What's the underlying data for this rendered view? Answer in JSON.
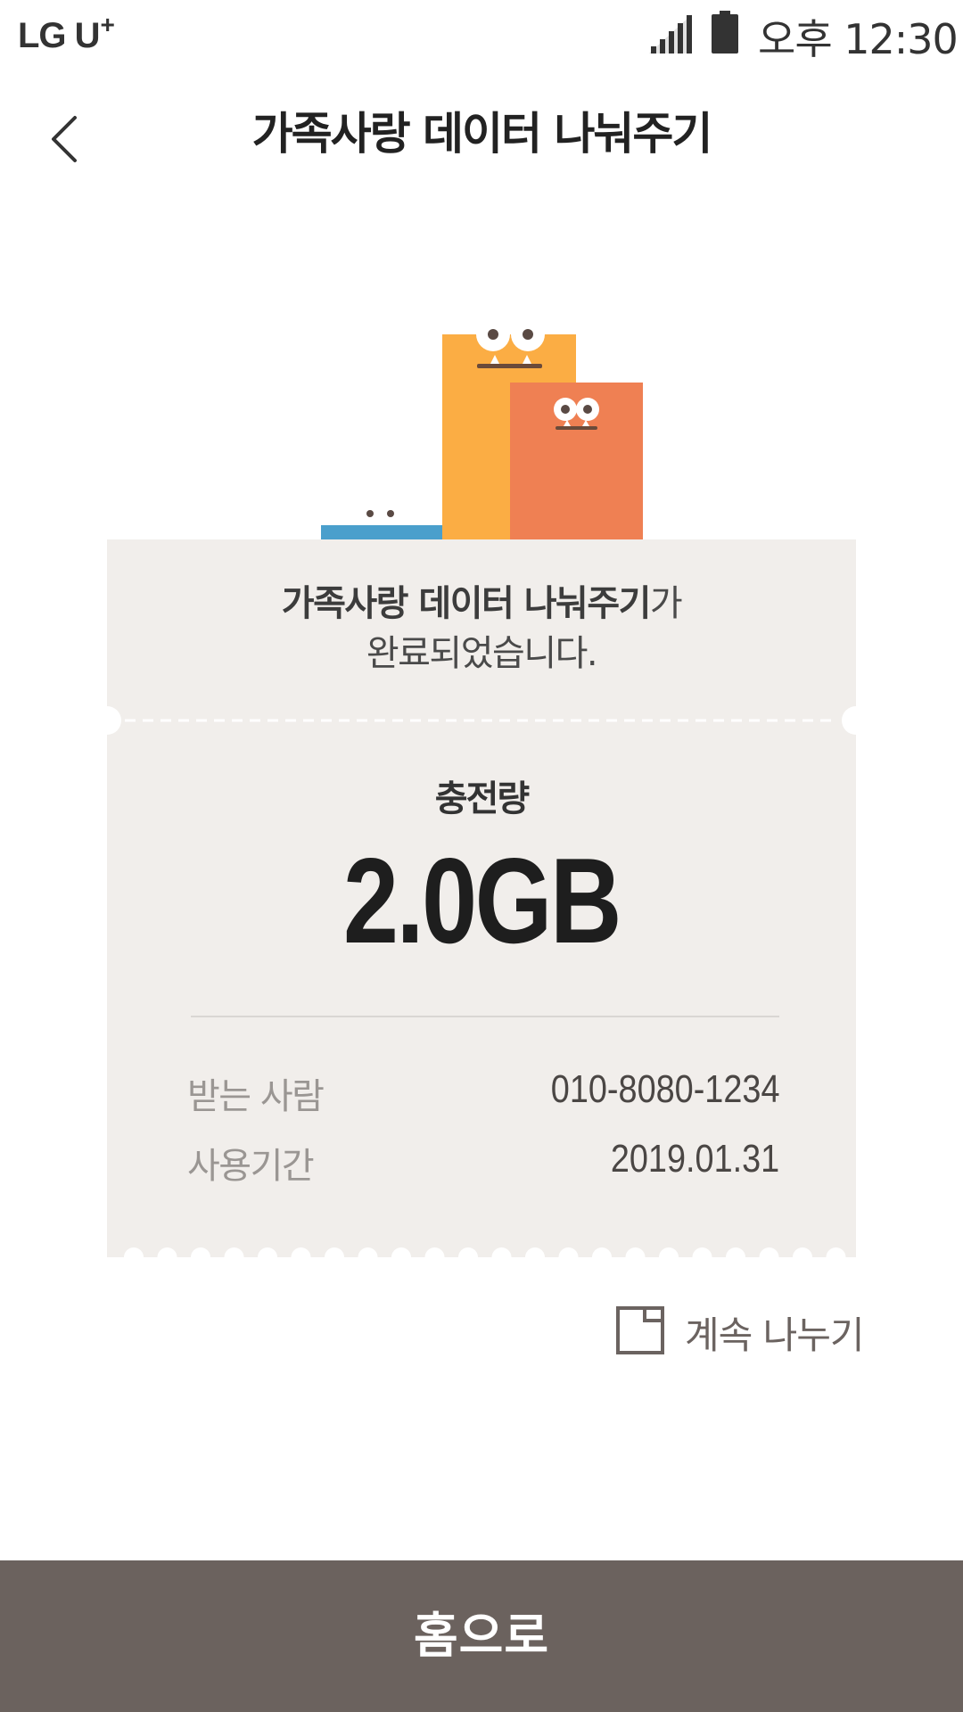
{
  "status_bar": {
    "carrier": "LG U",
    "carrier_sup": "+",
    "time": "오후 12:30",
    "icons": [
      "signal-icon",
      "battery-icon"
    ]
  },
  "header": {
    "back_icon": "chevron-left-icon",
    "title": "가족사랑 데이터 나눠주기"
  },
  "result": {
    "message_bold": "가족사랑 데이터 나눠주기",
    "message_suffix": "가",
    "message_line2": "완료되었습니다.",
    "charge_label": "충전량",
    "charge_amount": "2.0GB"
  },
  "details": [
    {
      "label": "받는 사람",
      "value": "010-8080-1234"
    },
    {
      "label": "사용기간",
      "value": "2019.01.31"
    }
  ],
  "continue_share": {
    "icon": "note-icon",
    "label": "계속 나누기"
  },
  "home_button": {
    "label": "홈으로"
  },
  "colors": {
    "ticket_bg": "#f1eeeb",
    "button_bg": "#6b625e",
    "character_yellow": "#fbad44",
    "character_orange": "#ef8053",
    "character_blue": "#4a9fcc"
  }
}
